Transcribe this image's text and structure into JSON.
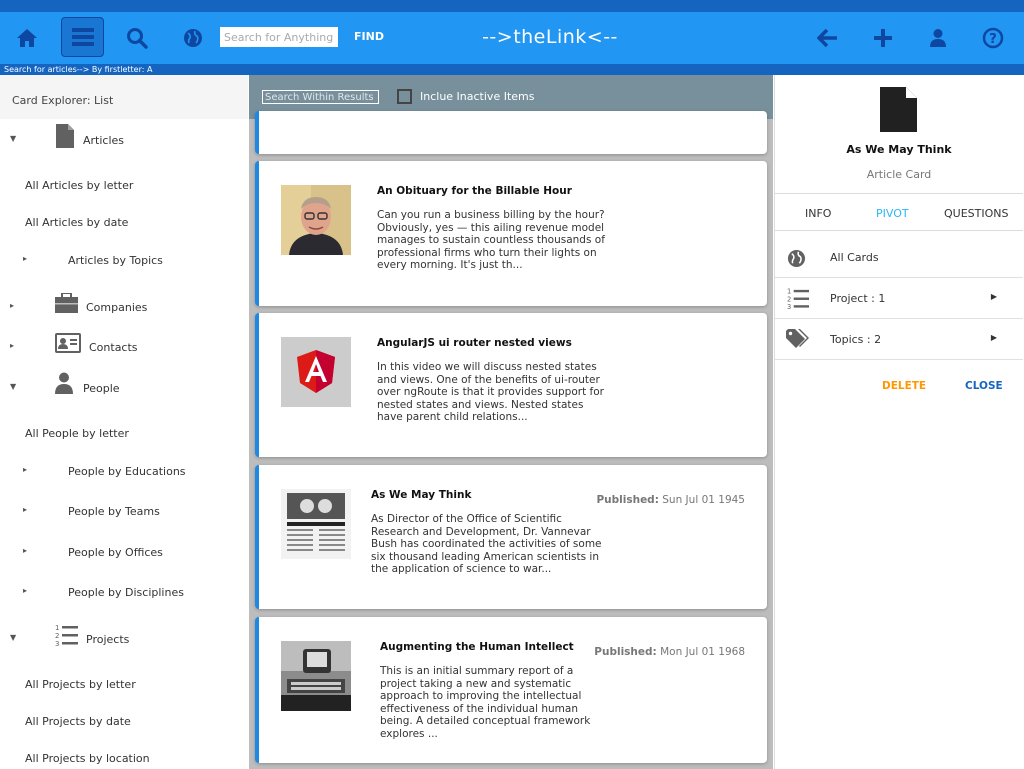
{
  "header": {
    "search_placeholder": "Search for Anything!",
    "find_label": "FIND",
    "app_title": "-->theLink<--",
    "breadcrumb": "Search for articles--> By firstletter: A"
  },
  "sidebar": {
    "title": "Card Explorer: List",
    "items": [
      {
        "label": "Articles",
        "icon": "document-icon"
      },
      {
        "label": "All Articles by letter"
      },
      {
        "label": "All Articles by date"
      },
      {
        "label": "Articles by Topics"
      },
      {
        "label": "Companies",
        "icon": "briefcase-icon"
      },
      {
        "label": "Contacts",
        "icon": "contact-card-icon"
      },
      {
        "label": "People",
        "icon": "person-icon"
      },
      {
        "label": "All People by letter"
      },
      {
        "label": "People by Educations"
      },
      {
        "label": "People by Teams"
      },
      {
        "label": "People by Offices"
      },
      {
        "label": "People by Disciplines"
      },
      {
        "label": "Projects",
        "icon": "numbered-list-icon"
      },
      {
        "label": "All Projects by letter"
      },
      {
        "label": "All Projects by date"
      },
      {
        "label": "All Projects by location"
      }
    ]
  },
  "main": {
    "within_placeholder": "Search Within Results",
    "inactive_label": "Inclue Inactive Items",
    "cards": [
      {
        "title": "An Obituary for the Billable Hour",
        "text": "Can you run a business billing by the hour? Obviously, yes — this ailing revenue model manages to sustain countless thousands of professional firms who turn their lights on every morning. It's just th...",
        "published_label": "",
        "published_date": "",
        "thumb": "portrait-photo"
      },
      {
        "title": "AngularJS ui router nested views",
        "text": "In this video we will discuss nested states and views. One of the benefits of ui-router over ngRoute is that it provides support for nested states and views. Nested states have parent child relations...",
        "published_label": "",
        "published_date": "",
        "thumb": "angular-logo"
      },
      {
        "title": "As We May Think",
        "text": "As Director of the Office of Scientific Research and Development, Dr. Vannevar Bush has coordinated the activities of some six thousand leading American scientists in the application of science to war...",
        "published_label": "Published:",
        "published_date": "Sun Jul 01 1945",
        "thumb": "newspaper-clipping"
      },
      {
        "title": "Augmenting the Human Intellect",
        "text": "This is an initial summary report of a project taking a new and systematic approach to improving the intellectual effectiveness of the individual human being. A detailed conceptual framework explores ...",
        "published_label": "Published:",
        "published_date": "Mon Jul 01 1968",
        "thumb": "computer-photo"
      }
    ]
  },
  "detail": {
    "title": "As We May Think",
    "subtitle": "Article Card",
    "tabs": [
      "INFO",
      "PIVOT",
      "QUESTIONS"
    ],
    "active_tab": "PIVOT",
    "rows": [
      {
        "label": "All Cards",
        "icon": "globe-icon"
      },
      {
        "label": "Project : 1",
        "icon": "numbered-list-icon"
      },
      {
        "label": "Topics : 2",
        "icon": "tags-icon"
      }
    ],
    "delete_label": "DELETE",
    "close_label": "CLOSE"
  },
  "colors": {
    "topbar": "#2196f3",
    "topbar_dark": "#1565c0",
    "accent": "#1e88e5",
    "delete": "#ff9800",
    "active_tab": "#29b6f6",
    "toolbar_grey": "#78909c"
  }
}
